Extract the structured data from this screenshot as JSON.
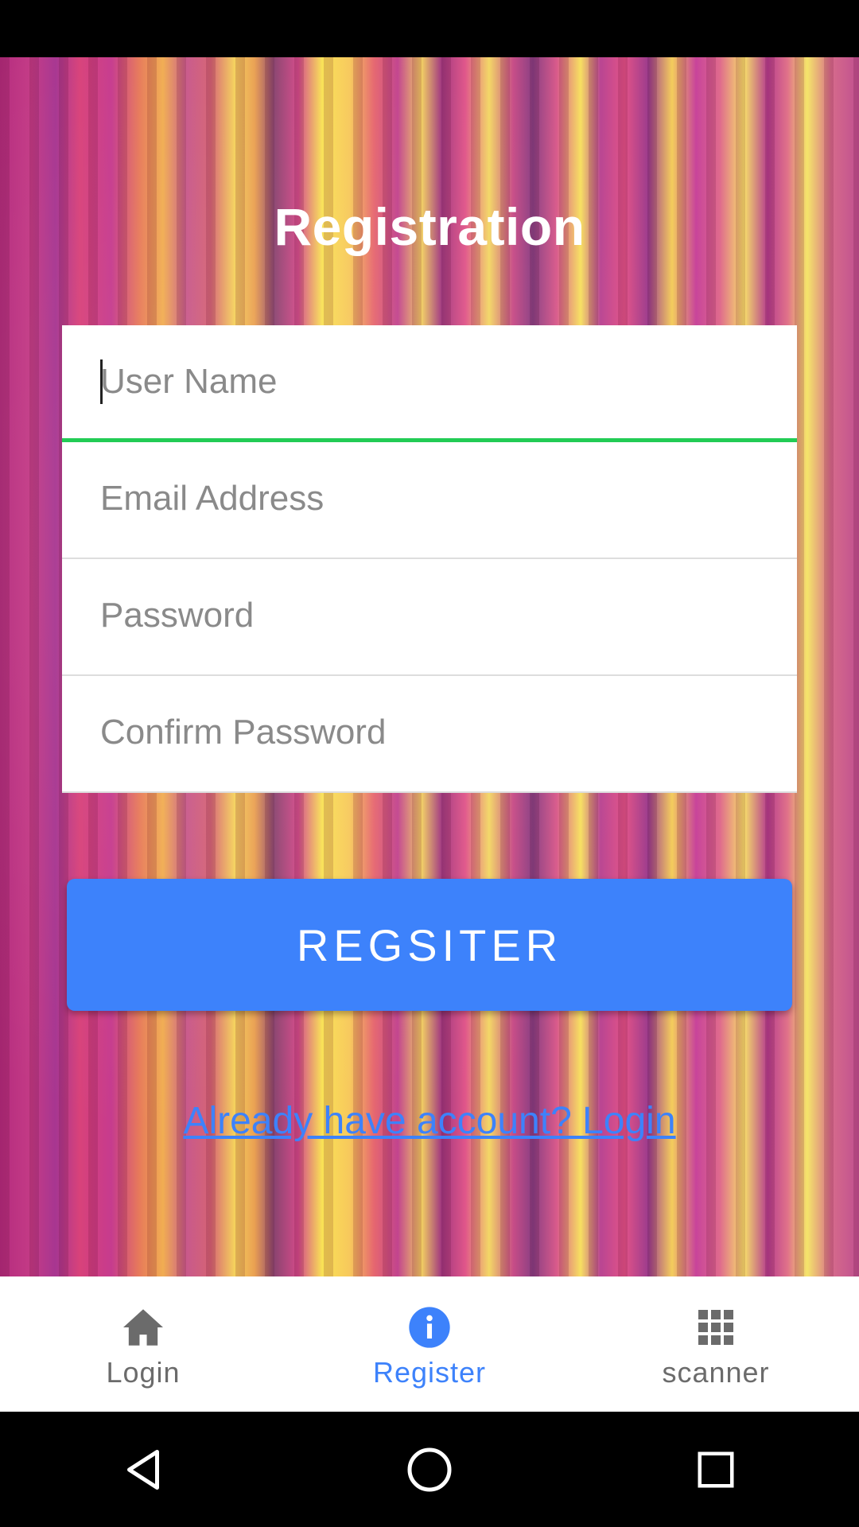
{
  "page": {
    "title": "Registration"
  },
  "form": {
    "username": {
      "placeholder": "User Name",
      "value": ""
    },
    "email": {
      "placeholder": "Email Address",
      "value": ""
    },
    "password": {
      "placeholder": "Password",
      "value": ""
    },
    "confirm_password": {
      "placeholder": "Confirm Password",
      "value": ""
    }
  },
  "actions": {
    "register_label": "REGSITER",
    "login_link_label": "Already have account? Login"
  },
  "bottom_nav": {
    "items": [
      {
        "label": "Login",
        "icon": "home-icon",
        "active": false
      },
      {
        "label": "Register",
        "icon": "info-icon",
        "active": true
      },
      {
        "label": "scanner",
        "icon": "grid-icon",
        "active": false
      }
    ]
  },
  "system_nav": {
    "buttons": [
      "back-icon",
      "home-circle-icon",
      "recents-icon"
    ]
  },
  "colors": {
    "accent": "#3d82fb",
    "focus_underline": "#22cc55",
    "title_text": "#ffffff"
  }
}
